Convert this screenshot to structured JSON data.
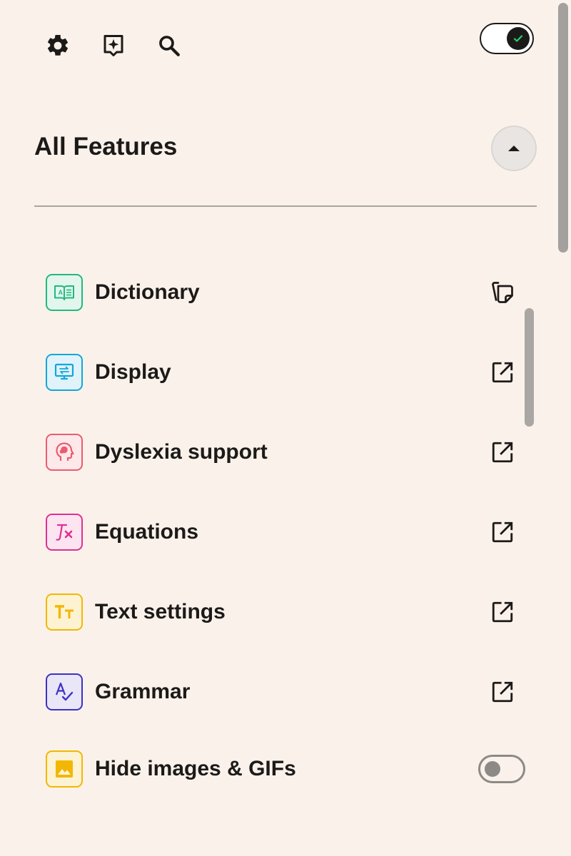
{
  "toolbar": {
    "icons": [
      "gear-icon",
      "sparkle-bubble-icon",
      "search-icon"
    ]
  },
  "master_toggle": {
    "state": "on",
    "check_color": "#2bd16b"
  },
  "section": {
    "title": "All Features",
    "collapse_icon": "caret-up-icon"
  },
  "features": [
    {
      "label": "Dictionary",
      "icon": "book-icon",
      "color": "#1fba7d",
      "bg": "#e3f6ee",
      "action": "copy-icon"
    },
    {
      "label": "Display",
      "icon": "monitor-icon",
      "color": "#14a6d9",
      "bg": "#e0f3fb",
      "action": "open-external-icon"
    },
    {
      "label": "Dyslexia support",
      "icon": "head-icon",
      "color": "#ec5b6f",
      "bg": "#fde9ea",
      "action": "open-external-icon"
    },
    {
      "label": "Equations",
      "icon": "formula-icon",
      "color": "#e02f92",
      "bg": "#fce4f0",
      "action": "open-external-icon"
    },
    {
      "label": "Text settings",
      "icon": "text-size-icon",
      "color": "#f2b705",
      "bg": "#fdf3d3",
      "action": "open-external-icon"
    },
    {
      "label": "Grammar",
      "icon": "spellcheck-icon",
      "color": "#3e30c4",
      "bg": "#e8e6f7",
      "action": "open-external-icon"
    },
    {
      "label": "Hide images & GIFs",
      "icon": "image-icon",
      "color": "#f2b705",
      "bg": "#fdf3d3",
      "action": "toggle",
      "toggle_state": "off"
    }
  ]
}
